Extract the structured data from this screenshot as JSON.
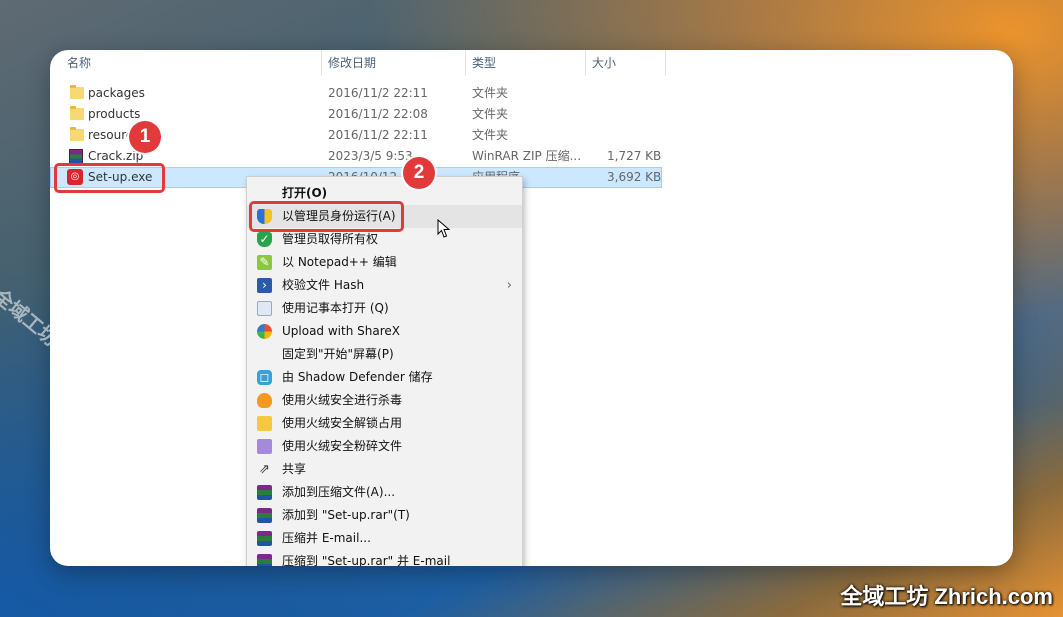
{
  "columns": {
    "name": "名称",
    "date": "修改日期",
    "type": "类型",
    "size": "大小"
  },
  "files": [
    {
      "name": "packages",
      "date": "2016/11/2 22:11",
      "type": "文件夹",
      "size": "",
      "icon": "folder-icon"
    },
    {
      "name": "products",
      "date": "2016/11/2 22:08",
      "type": "文件夹",
      "size": "",
      "icon": "folder-icon"
    },
    {
      "name": "resources",
      "date": "2016/11/2 22:11",
      "type": "文件夹",
      "size": "",
      "icon": "folder-icon"
    },
    {
      "name": "Crack.zip",
      "date": "2023/3/5 9:53",
      "type": "WinRAR ZIP 压缩...",
      "size": "1,727 KB",
      "icon": "winrar-icon"
    },
    {
      "name": "Set-up.exe",
      "date": "2016/10/12 7:",
      "type": "应用程序",
      "size": "3,692 KB",
      "icon": "adobe-setup-icon"
    }
  ],
  "menu": [
    {
      "label": "打开(O)",
      "icon": ""
    },
    {
      "label": "以管理员身份运行(A)",
      "icon": "uac-shield-icon"
    },
    {
      "label": "管理员取得所有权",
      "icon": "green-shield-icon"
    },
    {
      "label": "以 Notepad++ 编辑",
      "icon": "notepadpp-icon"
    },
    {
      "label": "校验文件 Hash",
      "icon": "powershell-icon"
    },
    {
      "label": "使用记事本打开 (Q)",
      "icon": "notepad-icon"
    },
    {
      "label": "Upload with ShareX",
      "icon": "sharex-icon"
    },
    {
      "label": "固定到\"开始\"屏幕(P)",
      "icon": ""
    },
    {
      "label": "由 Shadow Defender 储存",
      "icon": "shadow-defender-icon"
    },
    {
      "label": "使用火绒安全进行杀毒",
      "icon": "huorong-icon"
    },
    {
      "label": "使用火绒安全解锁占用",
      "icon": "unlock-folder-icon"
    },
    {
      "label": "使用火绒安全粉碎文件",
      "icon": "shredder-icon"
    },
    {
      "label": "共享",
      "icon": "share-icon"
    },
    {
      "label": "添加到压缩文件(A)...",
      "icon": "winrar-icon"
    },
    {
      "label": "添加到 \"Set-up.rar\"(T)",
      "icon": "winrar-icon"
    },
    {
      "label": "压缩并 E-mail...",
      "icon": "winrar-icon"
    },
    {
      "label": "压缩到 \"Set-up.rar\" 并 E-mail",
      "icon": "winrar-icon"
    }
  ],
  "badges": {
    "one": "1",
    "two": "2"
  },
  "watermarks": {
    "diagonal": "全域工坊 zhrich.com",
    "corner": "全域工坊 Zhrich.com"
  },
  "colors": {
    "highlight": "#e03b3b",
    "selection": "#cce8ff"
  }
}
